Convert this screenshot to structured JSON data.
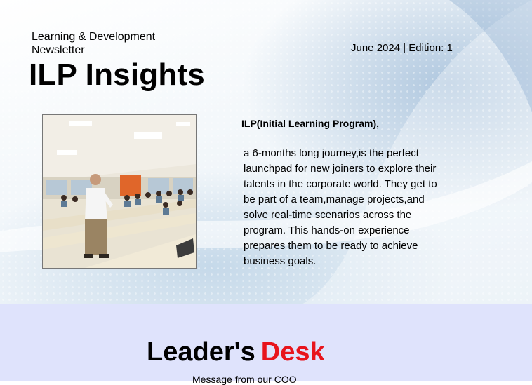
{
  "header": {
    "subtitle_line1": "Learning & Development",
    "subtitle_line2": "Newsletter",
    "edition": "June 2024 | Edition: 1",
    "title": "ILP Insights"
  },
  "intro": {
    "heading": "ILP(Initial Learning Program),",
    "body": "a 6-months long journey,is the perfect launchpad for new joiners to explore their talents in the corporate world. They get to be part of a team,manage projects,and solve real-time scenarios across the program. This hands-on experience prepares them to be ready to achieve business goals."
  },
  "leader": {
    "title_word1": "Leader's",
    "title_word2": "Desk",
    "subtitle": "Message from our COO"
  },
  "colors": {
    "accent_red": "#e8141c",
    "leader_bg": "#dfe3fc"
  }
}
